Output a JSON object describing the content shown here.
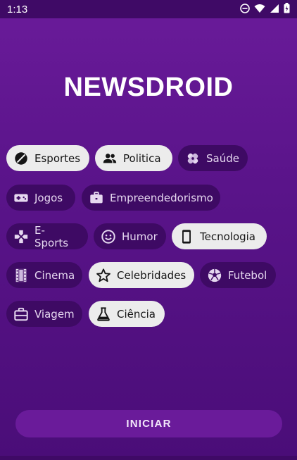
{
  "status": {
    "time": "1:13",
    "icons": [
      "do-not-disturb-icon",
      "wifi-icon",
      "signal-icon",
      "battery-icon"
    ]
  },
  "app": {
    "title": "NEWSDROID"
  },
  "categories": [
    {
      "label": "Esportes",
      "icon": "football-icon",
      "selected": true
    },
    {
      "label": "Politica",
      "icon": "people-icon",
      "selected": true
    },
    {
      "label": "Saúde",
      "icon": "bandage-icon",
      "selected": false
    },
    {
      "label": "Jogos",
      "icon": "gamepad-icon",
      "selected": false
    },
    {
      "label": "Empreendedorismo",
      "icon": "briefcase-icon",
      "selected": false
    },
    {
      "label": "E-Sports",
      "icon": "dpad-icon",
      "selected": false
    },
    {
      "label": "Humor",
      "icon": "smiley-icon",
      "selected": false
    },
    {
      "label": "Tecnologia",
      "icon": "smartphone-icon",
      "selected": true
    },
    {
      "label": "Cinema",
      "icon": "film-icon",
      "selected": false
    },
    {
      "label": "Celebridades",
      "icon": "star-icon",
      "selected": true
    },
    {
      "label": "Futebol",
      "icon": "soccer-ball-icon",
      "selected": false
    },
    {
      "label": "Viagem",
      "icon": "suitcase-icon",
      "selected": false
    },
    {
      "label": "Ciência",
      "icon": "flask-icon",
      "selected": true
    }
  ],
  "actions": {
    "start_label": "INICIAR"
  },
  "colors": {
    "background": "#5a148a",
    "chip_unselected": "#3e0a64",
    "chip_selected": "#ececec",
    "button": "#6a1b9a"
  }
}
